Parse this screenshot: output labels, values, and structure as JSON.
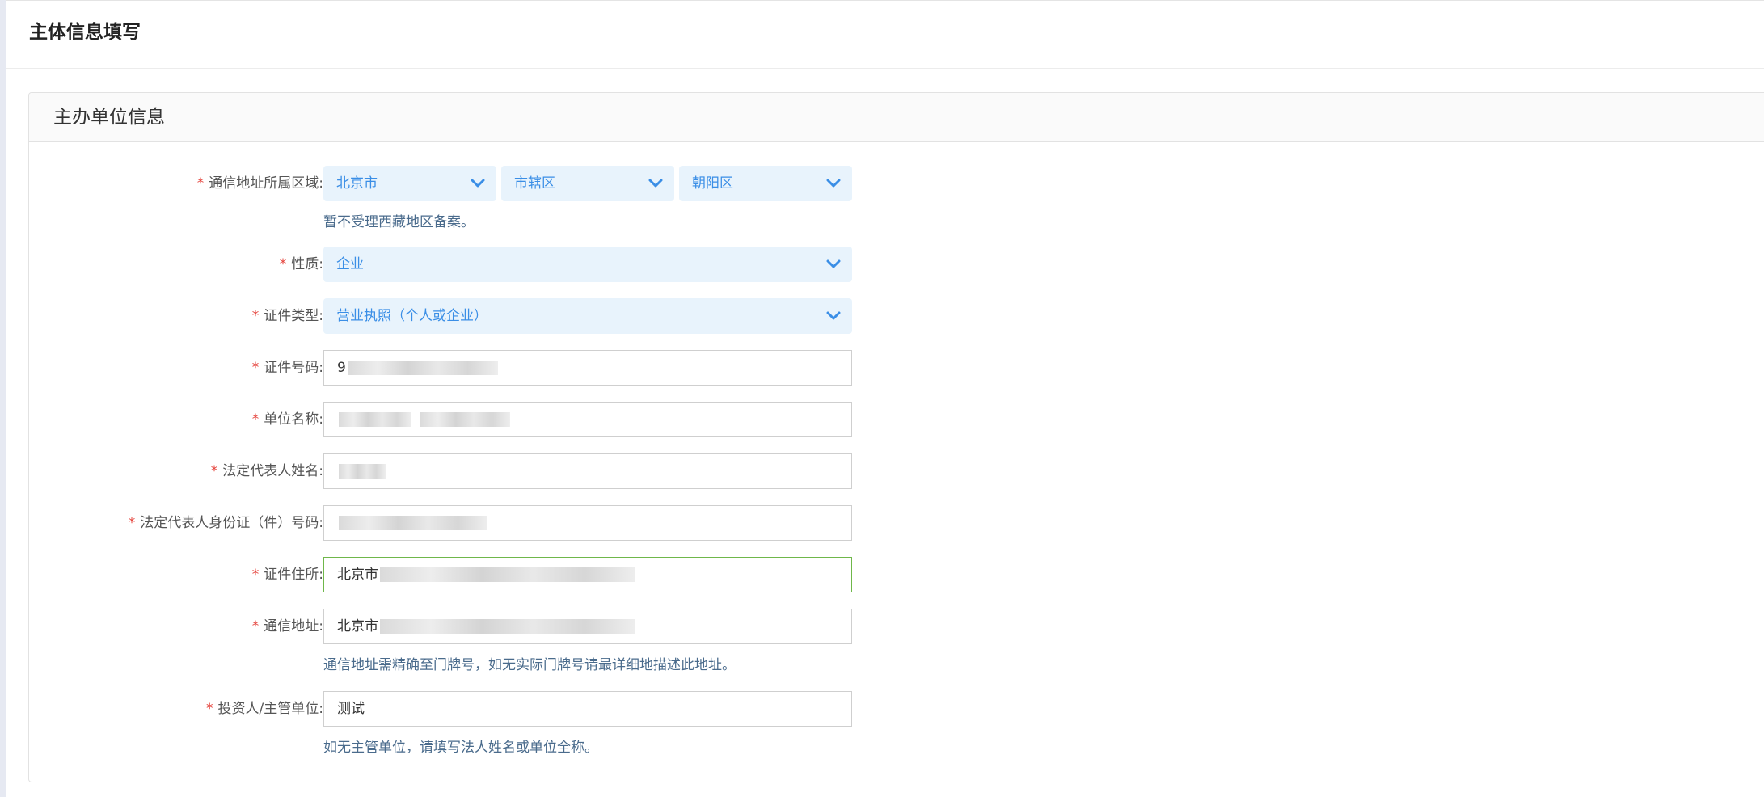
{
  "page": {
    "title": "主体信息填写"
  },
  "panel": {
    "title": "主办单位信息"
  },
  "form": {
    "region": {
      "label": "通信地址所属区域:",
      "province": "北京市",
      "city": "市辖区",
      "district": "朝阳区",
      "hint": "暂不受理西藏地区备案。"
    },
    "nature": {
      "label": "性质:",
      "value": "企业"
    },
    "cert_type": {
      "label": "证件类型:",
      "value": "营业执照（个人或企业）"
    },
    "cert_number": {
      "label": "证件号码:",
      "value": "9"
    },
    "unit_name": {
      "label": "单位名称:",
      "value": ""
    },
    "legal_rep_name": {
      "label": "法定代表人姓名:",
      "value": ""
    },
    "legal_rep_id": {
      "label": "法定代表人身份证（件）号码:",
      "value": ""
    },
    "cert_address": {
      "label": "证件住所:",
      "value": "北京市"
    },
    "mail_address": {
      "label": "通信地址:",
      "value": "北京市",
      "hint": "通信地址需精确至门牌号，如无实际门牌号请最详细地描述此地址。"
    },
    "investor": {
      "label": "投资人/主管单位:",
      "value": "测试",
      "hint": "如无主管单位，请填写法人姓名或单位全称。"
    },
    "required_mark": "*"
  },
  "colors": {
    "accent": "#3a8ee6",
    "select_bg": "#e8f3fc",
    "required": "#e5423b",
    "focus_border": "#6fb74a",
    "hint_text": "#4a6b8c"
  },
  "icons": {
    "dropdown": "chevron-down-icon"
  }
}
